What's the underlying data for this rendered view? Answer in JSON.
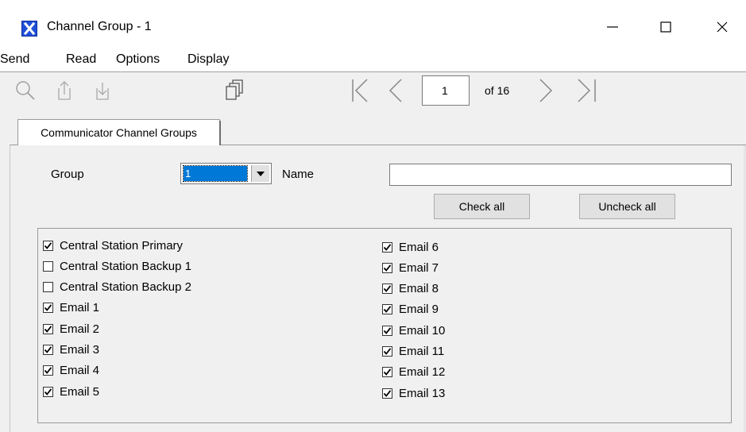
{
  "window": {
    "title": "Channel Group - 1",
    "icon": "x-app-icon",
    "controls": [
      "minimize-icon",
      "maximize-icon",
      "close-icon"
    ]
  },
  "menu": [
    "Send",
    "Read",
    "Options",
    "Display"
  ],
  "toolbar": {
    "icons": [
      "search-icon",
      "upload-icon",
      "download-icon",
      "copy-icon",
      "first-page-icon",
      "prev-page-icon",
      "next-page-icon",
      "last-page-icon"
    ],
    "page_number": "1",
    "page_of": "of 16"
  },
  "tab": {
    "label": "Communicator Channel Groups"
  },
  "form": {
    "group_label": "Group",
    "group_value": "1",
    "name_label": "Name",
    "name_value": "",
    "check_all": "Check all",
    "uncheck_all": "Uncheck all"
  },
  "channels_left": [
    {
      "label": "Central Station Primary",
      "checked": true
    },
    {
      "label": "Central Station Backup 1",
      "checked": false
    },
    {
      "label": "Central Station Backup 2",
      "checked": false
    },
    {
      "label": "Email 1",
      "checked": true
    },
    {
      "label": "Email 2",
      "checked": true
    },
    {
      "label": "Email 3",
      "checked": true
    },
    {
      "label": "Email 4",
      "checked": true
    },
    {
      "label": "Email 5",
      "checked": true
    }
  ],
  "channels_right": [
    {
      "label": "Email 6",
      "checked": true
    },
    {
      "label": "Email 7",
      "checked": true
    },
    {
      "label": "Email 8",
      "checked": true
    },
    {
      "label": "Email 9",
      "checked": true
    },
    {
      "label": "Email 10",
      "checked": true
    },
    {
      "label": "Email 11",
      "checked": true
    },
    {
      "label": "Email 12",
      "checked": true
    },
    {
      "label": "Email 13",
      "checked": true
    }
  ],
  "colors": {
    "accent": "#0078d7",
    "app_icon": "#1f4fd8"
  }
}
